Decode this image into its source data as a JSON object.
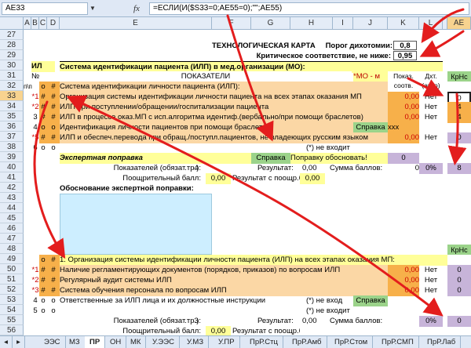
{
  "formula_bar": {
    "name_box": "AE33",
    "fx": "fx",
    "formula": "=ЕСЛИ(И($S33=0;AE55=0);\"\";AE55)"
  },
  "columns": [
    "A",
    "B",
    "C",
    "D",
    "E",
    "F",
    "G",
    "H",
    "I",
    "J",
    "K",
    "L",
    "M",
    "AE"
  ],
  "rows": {
    "r27": "27",
    "r28": "28",
    "r29": "29",
    "r30": "30",
    "r31": "31",
    "r32": "32",
    "r33": "33",
    "r34": "34",
    "r35": "35",
    "r36": "36",
    "r37": "37",
    "r38": "38",
    "r39": "39",
    "r40": "40",
    "r41": "41",
    "r42": "42",
    "r43": "43",
    "r44": "44",
    "r45": "45",
    "r46": "46",
    "r47": "47",
    "r48": "48",
    "r49": "49",
    "r50": "50",
    "r51": "51",
    "r52": "52",
    "r53": "53",
    "r54": "54",
    "r55": "55",
    "r56": "56"
  },
  "sheet": {
    "title": "ТЕХНОЛОГИЧЕСКАЯ КАРТА",
    "threshold_label": "Порог дихотомии:",
    "threshold_value": "0,8",
    "critical_label": "Критическое соответствие, не ниже:",
    "critical_value": "0,95",
    "ilp_label": "ИЛ",
    "system_title": "Система идентификации пациента (ИЛП) в мед.организации (МО):",
    "num_header": "№",
    "np_header": "п\\п",
    "indicators_header": "ПОКАЗАТЕЛИ",
    "mo_tag": "*МО - м",
    "show_header": "Показ. соотв.",
    "dht_header": "Дхт. (авто)",
    "krns_header": "КрНс",
    "hash": "#",
    "o_mark": "о",
    "r32_text": "Система идентификации личности пациента (ИЛП):",
    "r33_text": "Организация системы идентификации личности пациента на всех этапах оказания МП",
    "r33_num": "*1",
    "r33_k": "0,00",
    "r33_l": "Нет",
    "r33_ae": "0",
    "r34_text": "ИЛП при поступлении/обращении/госпитализации пациента",
    "r34_num": "*2",
    "r34_k": "0,00",
    "r34_l": "Нет",
    "r34_ae": "4",
    "r35_text": "ИЛП в процессе оказ.МП с исп.алгоритма идентиф.(вербально/при помощи браслетов)",
    "r35_num": "3",
    "r35_k": "0,00",
    "r35_l": "Нет",
    "r35_ae": "4",
    "r36_text": "Идентификация личности пациентов при помощи браслетов",
    "r36_num": "4",
    "r36_ref": "Справка",
    "r36_xxx": "xxx",
    "r37_text": "ИЛП и обеспеч.перевода при обращ./поступл.пациентов, не владеющих русским языком",
    "r37_num": "*5",
    "r37_k": "0,00",
    "r37_l": "Нет",
    "r37_ae": "0",
    "r38_num": "6",
    "r38_note": "(*) не входит",
    "r39_text": "Экспертная поправка",
    "r39_ref": "Справка",
    "r39_fix": "Поправку обосновать!",
    "r39_k": "0",
    "r40_label": "Показателей (обязат.тр.):",
    "r40_count": "4",
    "r40_result_label": "Результат:",
    "r40_result": "0,00",
    "r40_sum_label": "Сумма баллов:",
    "r40_sum": "0",
    "r40_pct": "0%",
    "r40_ae": "8",
    "r41_label": "Поощрительный балл:",
    "r41_value": "0,00",
    "r41_result_label": "Результат с поощр.б.:",
    "r41_result": "0,00",
    "r42_text": "Обоснование экспертной поправки:",
    "r49_krns": "КрНс",
    "r49_text": "1.  Организация системы идентификации личности пациента (ИЛП) на всех этапах оказания МП:",
    "r50_num": "*1",
    "r50_text": "Наличие регламентирующих документов (порядков, приказов) по вопросам ИЛП",
    "r50_k": "0,00",
    "r50_l": "Нет",
    "r50_ae": "0",
    "r51_num": "*2",
    "r51_text": "Регулярный аудит системы ИЛП",
    "r51_k": "0,00",
    "r51_l": "Нет",
    "r51_ae": "0",
    "r52_num": "*3",
    "r52_text": "Система обучения персонала по вопросам ИЛП",
    "r52_k": "0,00",
    "r52_l": "Нет",
    "r52_ae": "0",
    "r53_num": "4",
    "r53_text": "Ответственные за ИЛП лица и их должностные инструкции",
    "r53_note": "(*) не вход",
    "r53_ref": "Справка",
    "r54_num": "5",
    "r54_note": "(*) не входит",
    "r55_label": "Показателей (обязат.тр.):",
    "r55_count": "3",
    "r55_result_label": "Результат:",
    "r55_result": "0,00",
    "r55_sum_label": "Сумма баллов:",
    "r55_pct": "0%",
    "r55_ae": "0",
    "r56_label": "Поощрительный балл:",
    "r56_value": "0,00",
    "r56_result_label": "Результат с поощр.б.:"
  },
  "tabs": [
    "ЭЭС",
    "МЗ",
    "ПР",
    "ОН",
    "МК",
    "У.ЭЭС",
    "У.МЗ",
    "У.ПР",
    "ПрР.Стц",
    "ПрР.Амб",
    "ПрР.Стом",
    "ПрР.СМП",
    "ПрР.Лаб"
  ],
  "active_tab": "ПР",
  "colors": {
    "orange": "#f7b04a",
    "lightorange": "#fbd7a5",
    "yellow": "#ffff99",
    "green": "#9bd38a",
    "cyan": "#cdeeff",
    "purple": "#c7b4d9",
    "red": "#e31d1d"
  }
}
